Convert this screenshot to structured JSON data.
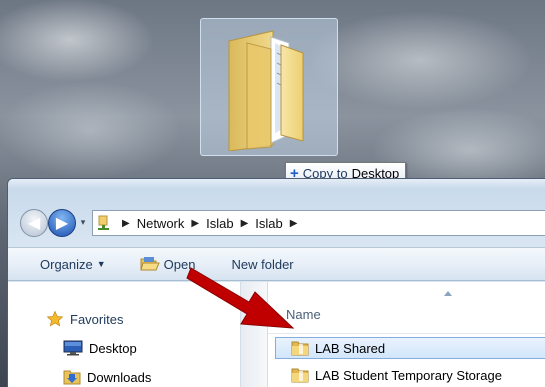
{
  "drag": {
    "tooltip_prefix": "Copy to",
    "tooltip_destination": "Desktop",
    "plus_glyph": "+"
  },
  "nav": {
    "back_glyph": "◀",
    "forward_glyph": "▶",
    "history_glyph": "▾",
    "breadcrumb": [
      "Network",
      "Islab",
      "Islab"
    ],
    "separator_glyph": "▶"
  },
  "toolbar": {
    "organize_label": "Organize",
    "organize_caret": "▼",
    "open_label": "Open",
    "new_folder_label": "New folder"
  },
  "sidebar": {
    "favorites_label": "Favorites",
    "items": [
      {
        "label": "Desktop",
        "icon": "desktop-icon"
      },
      {
        "label": "Downloads",
        "icon": "downloads-folder-icon"
      }
    ]
  },
  "file_list": {
    "name_column": "Name",
    "rows": [
      {
        "name": "LAB Shared",
        "selected": true
      },
      {
        "name": "LAB Student Temporary Storage",
        "selected": false
      }
    ]
  },
  "colors": {
    "accent_blue": "#1d5fc8",
    "selection_border": "#84acdd",
    "arrow_red": "#c00000",
    "folder_yellow": "#f2cf6a"
  }
}
